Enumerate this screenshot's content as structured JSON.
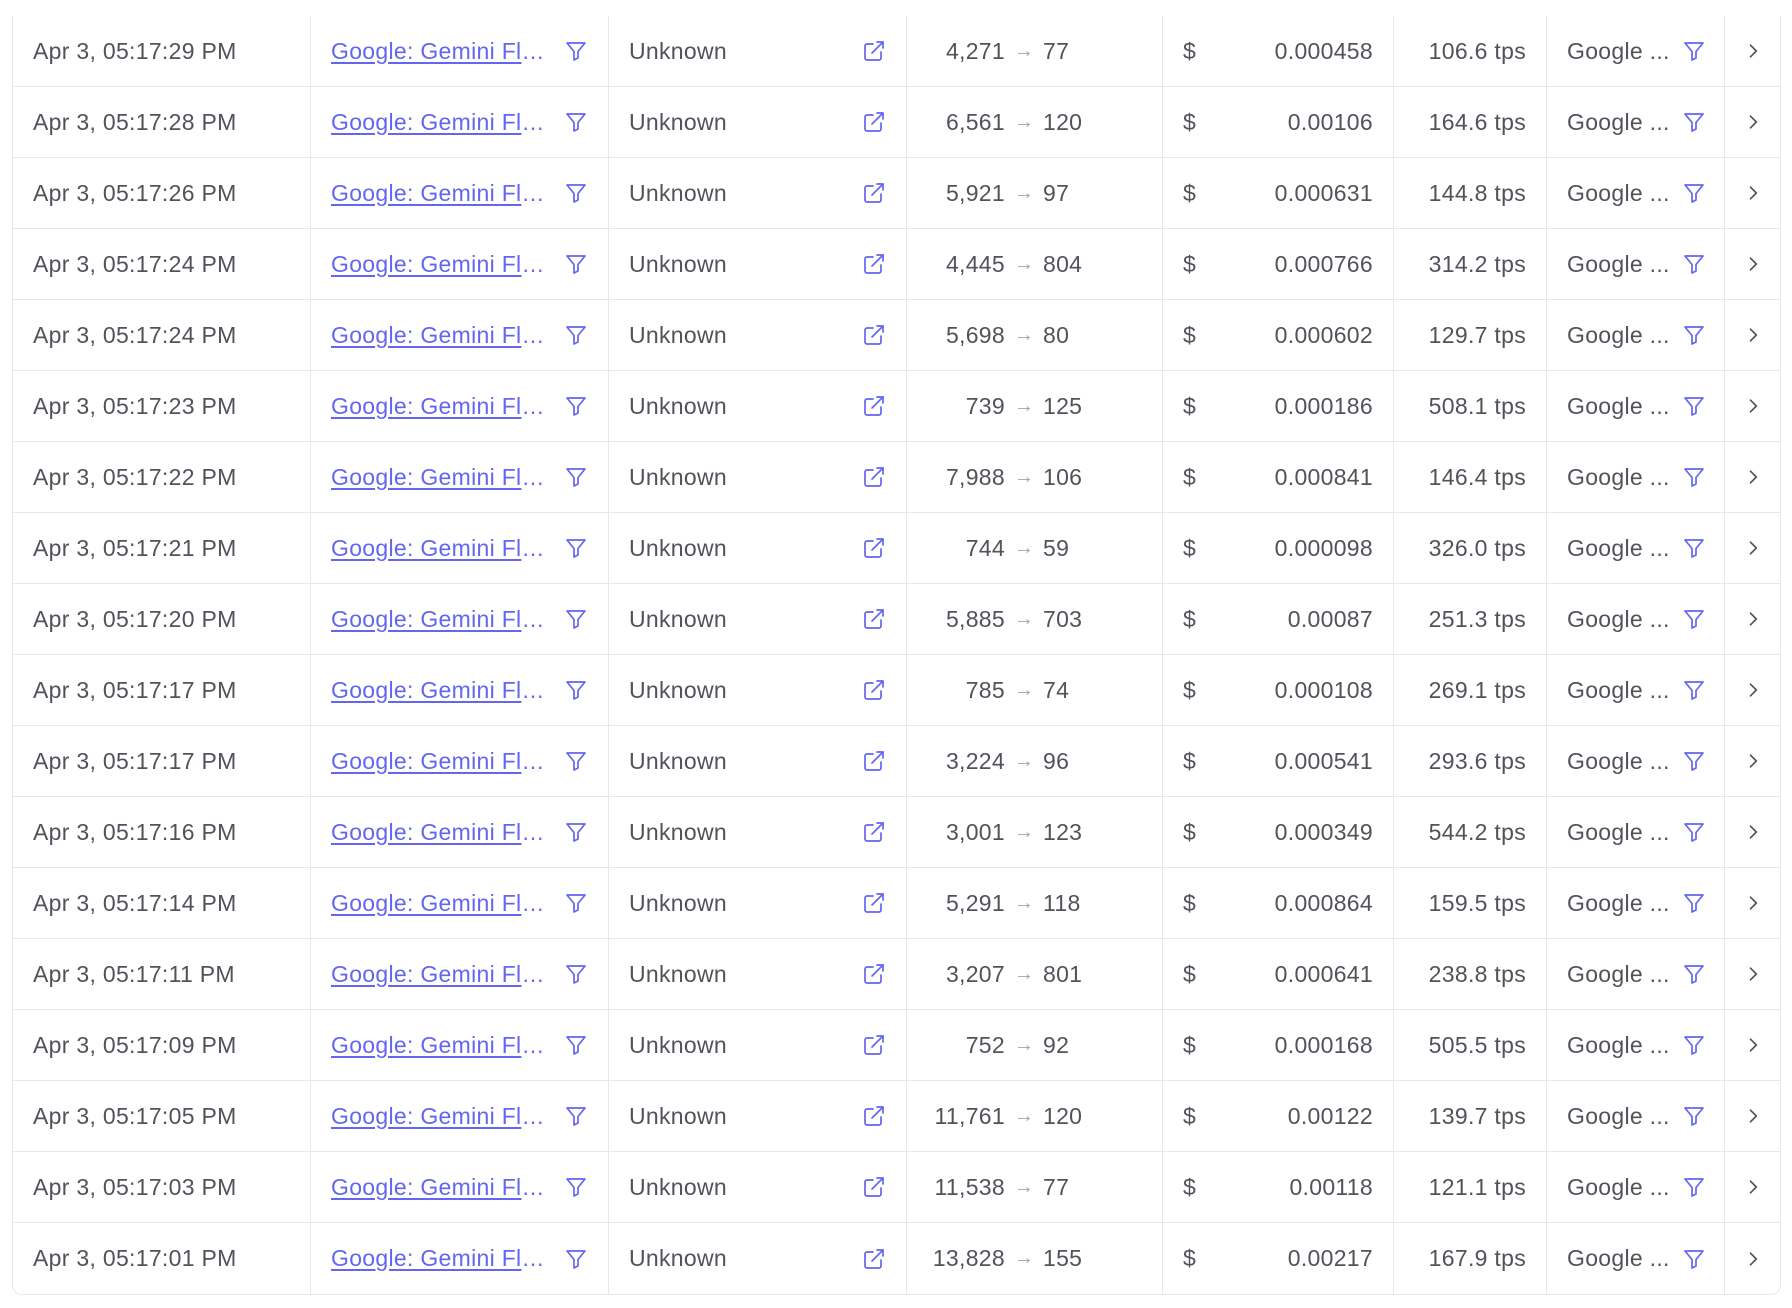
{
  "colors": {
    "link": "#6366f1",
    "border": "#e8e8ec",
    "text": "#52525b",
    "muted": "#a1a1aa"
  },
  "icons": {
    "filter": "filter-icon",
    "external": "external-link-icon",
    "arrow": "arrow-right-icon",
    "chevron": "chevron-right-icon"
  },
  "arrow_glyph": "→",
  "currency": "$",
  "rows": [
    {
      "time": "Apr 3, 05:17:29 PM",
      "model": "Google: Gemini Fla...",
      "app": "Unknown",
      "tokens_in": "4,271",
      "tokens_out": "77",
      "cost": "0.000458",
      "speed": "106.6 tps",
      "provider": "Google ..."
    },
    {
      "time": "Apr 3, 05:17:28 PM",
      "model": "Google: Gemini Fla...",
      "app": "Unknown",
      "tokens_in": "6,561",
      "tokens_out": "120",
      "cost": "0.00106",
      "speed": "164.6 tps",
      "provider": "Google ..."
    },
    {
      "time": "Apr 3, 05:17:26 PM",
      "model": "Google: Gemini Fla...",
      "app": "Unknown",
      "tokens_in": "5,921",
      "tokens_out": "97",
      "cost": "0.000631",
      "speed": "144.8 tps",
      "provider": "Google ..."
    },
    {
      "time": "Apr 3, 05:17:24 PM",
      "model": "Google: Gemini Fla...",
      "app": "Unknown",
      "tokens_in": "4,445",
      "tokens_out": "804",
      "cost": "0.000766",
      "speed": "314.2 tps",
      "provider": "Google ..."
    },
    {
      "time": "Apr 3, 05:17:24 PM",
      "model": "Google: Gemini Fla...",
      "app": "Unknown",
      "tokens_in": "5,698",
      "tokens_out": "80",
      "cost": "0.000602",
      "speed": "129.7 tps",
      "provider": "Google ..."
    },
    {
      "time": "Apr 3, 05:17:23 PM",
      "model": "Google: Gemini Fla...",
      "app": "Unknown",
      "tokens_in": "739",
      "tokens_out": "125",
      "cost": "0.000186",
      "speed": "508.1 tps",
      "provider": "Google ..."
    },
    {
      "time": "Apr 3, 05:17:22 PM",
      "model": "Google: Gemini Fla...",
      "app": "Unknown",
      "tokens_in": "7,988",
      "tokens_out": "106",
      "cost": "0.000841",
      "speed": "146.4 tps",
      "provider": "Google ..."
    },
    {
      "time": "Apr 3, 05:17:21 PM",
      "model": "Google: Gemini Fla...",
      "app": "Unknown",
      "tokens_in": "744",
      "tokens_out": "59",
      "cost": "0.000098",
      "speed": "326.0 tps",
      "provider": "Google ..."
    },
    {
      "time": "Apr 3, 05:17:20 PM",
      "model": "Google: Gemini Fla...",
      "app": "Unknown",
      "tokens_in": "5,885",
      "tokens_out": "703",
      "cost": "0.00087",
      "speed": "251.3 tps",
      "provider": "Google ..."
    },
    {
      "time": "Apr 3, 05:17:17 PM",
      "model": "Google: Gemini Fla...",
      "app": "Unknown",
      "tokens_in": "785",
      "tokens_out": "74",
      "cost": "0.000108",
      "speed": "269.1 tps",
      "provider": "Google ..."
    },
    {
      "time": "Apr 3, 05:17:17 PM",
      "model": "Google: Gemini Fla...",
      "app": "Unknown",
      "tokens_in": "3,224",
      "tokens_out": "96",
      "cost": "0.000541",
      "speed": "293.6 tps",
      "provider": "Google ..."
    },
    {
      "time": "Apr 3, 05:17:16 PM",
      "model": "Google: Gemini Fla...",
      "app": "Unknown",
      "tokens_in": "3,001",
      "tokens_out": "123",
      "cost": "0.000349",
      "speed": "544.2 tps",
      "provider": "Google ..."
    },
    {
      "time": "Apr 3, 05:17:14 PM",
      "model": "Google: Gemini Fla...",
      "app": "Unknown",
      "tokens_in": "5,291",
      "tokens_out": "118",
      "cost": "0.000864",
      "speed": "159.5 tps",
      "provider": "Google ..."
    },
    {
      "time": "Apr 3, 05:17:11 PM",
      "model": "Google: Gemini Fla...",
      "app": "Unknown",
      "tokens_in": "3,207",
      "tokens_out": "801",
      "cost": "0.000641",
      "speed": "238.8 tps",
      "provider": "Google ..."
    },
    {
      "time": "Apr 3, 05:17:09 PM",
      "model": "Google: Gemini Fla...",
      "app": "Unknown",
      "tokens_in": "752",
      "tokens_out": "92",
      "cost": "0.000168",
      "speed": "505.5 tps",
      "provider": "Google ..."
    },
    {
      "time": "Apr 3, 05:17:05 PM",
      "model": "Google: Gemini Fla...",
      "app": "Unknown",
      "tokens_in": "11,761",
      "tokens_out": "120",
      "cost": "0.00122",
      "speed": "139.7 tps",
      "provider": "Google ..."
    },
    {
      "time": "Apr 3, 05:17:03 PM",
      "model": "Google: Gemini Fla...",
      "app": "Unknown",
      "tokens_in": "11,538",
      "tokens_out": "77",
      "cost": "0.00118",
      "speed": "121.1 tps",
      "provider": "Google ..."
    },
    {
      "time": "Apr 3, 05:17:01 PM",
      "model": "Google: Gemini Fla...",
      "app": "Unknown",
      "tokens_in": "13,828",
      "tokens_out": "155",
      "cost": "0.00217",
      "speed": "167.9 tps",
      "provider": "Google ..."
    }
  ]
}
